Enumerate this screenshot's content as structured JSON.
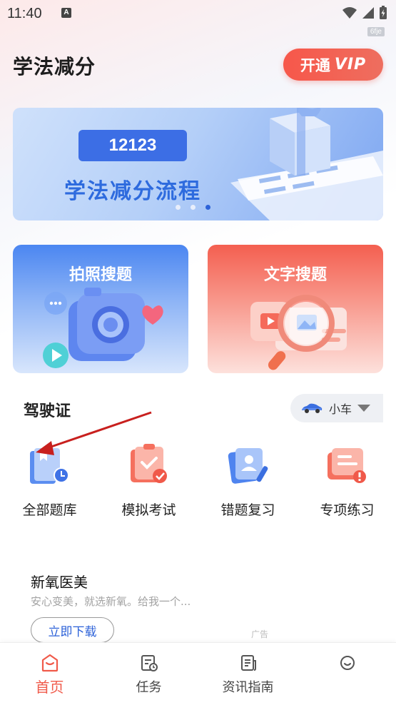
{
  "status_bar": {
    "time": "11:40",
    "notification_badge": "A",
    "watermark": "6fje"
  },
  "header": {
    "title": "学法减分",
    "vip_label": "开通",
    "vip_badge": "VIP"
  },
  "banner": {
    "code": "12123",
    "title": "学法减分流程",
    "dots": 3,
    "active_dot": 3
  },
  "search_cards": [
    {
      "label": "拍照搜题"
    },
    {
      "label": "文字搜题"
    }
  ],
  "license_section": {
    "title": "驾驶证",
    "vehicle_select": "小车",
    "items": [
      {
        "label": "全部题库",
        "icon": "question-bank-icon"
      },
      {
        "label": "模拟考试",
        "icon": "mock-exam-icon"
      },
      {
        "label": "错题复习",
        "icon": "wrong-questions-icon"
      },
      {
        "label": "专项练习",
        "icon": "special-practice-icon"
      }
    ]
  },
  "ad": {
    "title": "新氧医美",
    "description": "安心变美，就选新氧。给我一个...",
    "button": "立即下载",
    "tag": "广告"
  },
  "bottom_nav": [
    {
      "label": "首页",
      "icon": "home-icon",
      "active": true
    },
    {
      "label": "任务",
      "icon": "task-icon",
      "active": false
    },
    {
      "label": "资讯指南",
      "icon": "news-guide-icon",
      "active": false
    },
    {
      "label": "",
      "icon": "profile-icon",
      "active": false
    }
  ],
  "colors": {
    "accent": "#f05a4a",
    "blue": "#2d62d8"
  }
}
